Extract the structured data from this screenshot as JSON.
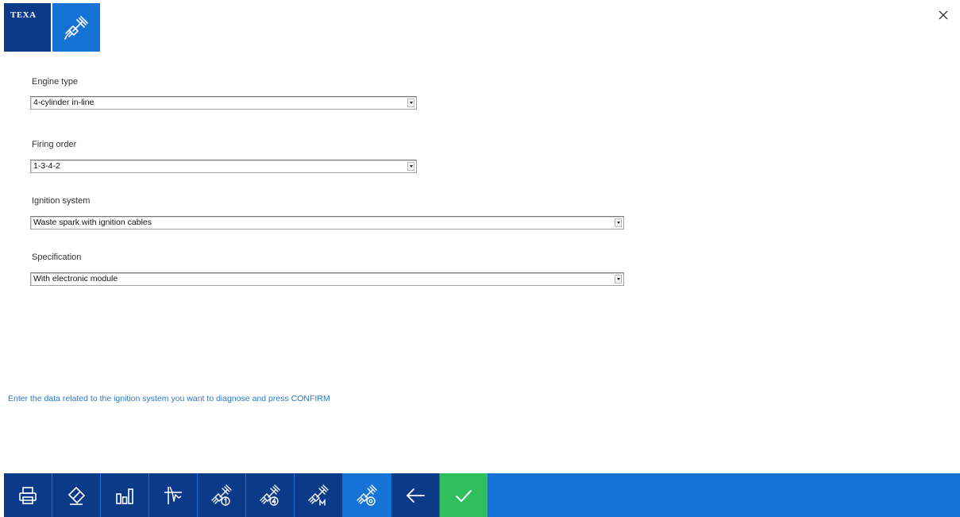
{
  "header": {
    "brand_text": "TEXA",
    "app_icon": "spark-plug-icon",
    "close_icon": "close-icon"
  },
  "form": {
    "engine_type": {
      "label": "Engine type",
      "value": "4-cylinder in-line"
    },
    "firing_order": {
      "label": "Firing order",
      "value": "1-3-4-2"
    },
    "ignition_system": {
      "label": "Ignition system",
      "value": "Waste spark with ignition cables"
    },
    "specification": {
      "label": "Specification",
      "value": "With electronic module"
    }
  },
  "hint": "Enter the data related to the ignition system you want to diagnose and press CONFIRM",
  "toolbar": {
    "buttons": [
      {
        "icon": "print-icon"
      },
      {
        "icon": "eraser-icon"
      },
      {
        "icon": "bar-chart-icon"
      },
      {
        "icon": "waveform-icon"
      },
      {
        "icon": "spark-plug-1-icon"
      },
      {
        "icon": "spark-plug-4-icon"
      },
      {
        "icon": "spark-plug-m-icon"
      },
      {
        "icon": "spark-plug-settings-icon"
      },
      {
        "icon": "back-arrow-icon"
      },
      {
        "icon": "confirm-check-icon"
      }
    ]
  },
  "colors": {
    "brand_dark": "#0b3a88",
    "brand_blue": "#1673d6",
    "confirm_green": "#2fbf5d",
    "hint_blue": "#2878c8"
  }
}
